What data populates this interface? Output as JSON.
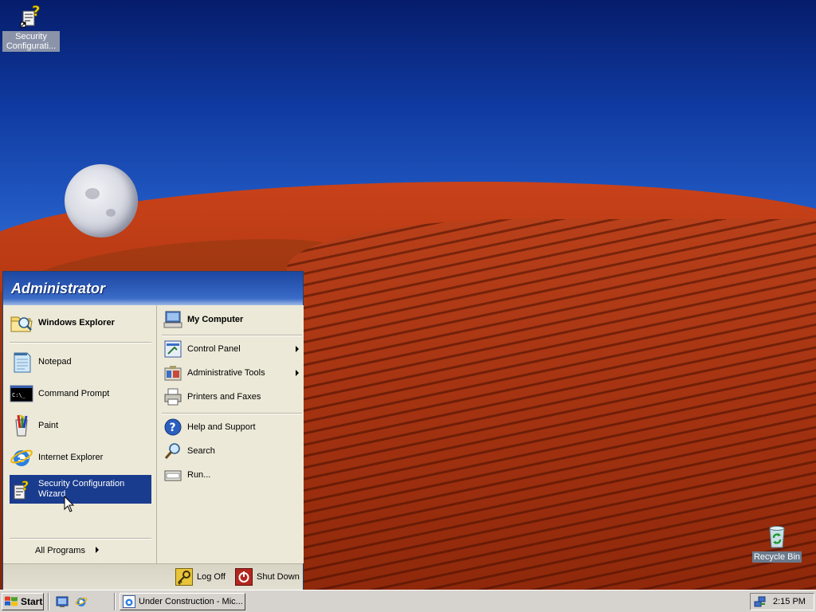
{
  "desktop": {
    "icons": [
      {
        "label": "Security Configurati...",
        "icon": "security-wizard-icon"
      },
      {
        "label": "Recycle Bin",
        "icon": "recycle-bin-icon"
      }
    ]
  },
  "start_menu": {
    "user": "Administrator",
    "pinned": [
      {
        "label": "Windows Explorer",
        "icon": "windows-explorer-icon"
      }
    ],
    "recent": [
      {
        "label": "Notepad",
        "icon": "notepad-icon"
      },
      {
        "label": "Command Prompt",
        "icon": "command-prompt-icon"
      },
      {
        "label": "Paint",
        "icon": "paint-icon"
      },
      {
        "label": "Internet Explorer",
        "icon": "internet-explorer-icon"
      },
      {
        "label": "Security Configuration Wizard",
        "icon": "security-wizard-icon",
        "highlighted": true
      }
    ],
    "all_programs": "All Programs",
    "right": [
      {
        "label": "My Computer",
        "icon": "my-computer-icon"
      },
      {
        "label": "Control Panel",
        "icon": "control-panel-icon",
        "submenu": true
      },
      {
        "label": "Administrative Tools",
        "icon": "administrative-tools-icon",
        "submenu": true
      },
      {
        "label": "Printers and Faxes",
        "icon": "printers-icon"
      },
      {
        "label": "Help and Support",
        "icon": "help-icon"
      },
      {
        "label": "Search",
        "icon": "search-icon"
      },
      {
        "label": "Run...",
        "icon": "run-icon"
      }
    ],
    "footer": {
      "log_off": "Log Off",
      "shut_down": "Shut Down"
    }
  },
  "taskbar": {
    "start_label": "Start",
    "quick_launch": [
      {
        "icon": "show-desktop-icon"
      },
      {
        "icon": "internet-explorer-icon"
      }
    ],
    "tasks": [
      {
        "label": "Under Construction - Mic...",
        "icon": "internet-explorer-icon"
      }
    ],
    "tray": {
      "clock": "2:15 PM",
      "icons": [
        {
          "icon": "network-icon"
        }
      ]
    }
  },
  "colors": {
    "menu_highlight": "#1a3c8e",
    "menu_background": "#ece9d8",
    "header_blue": "#2d5cb9"
  }
}
